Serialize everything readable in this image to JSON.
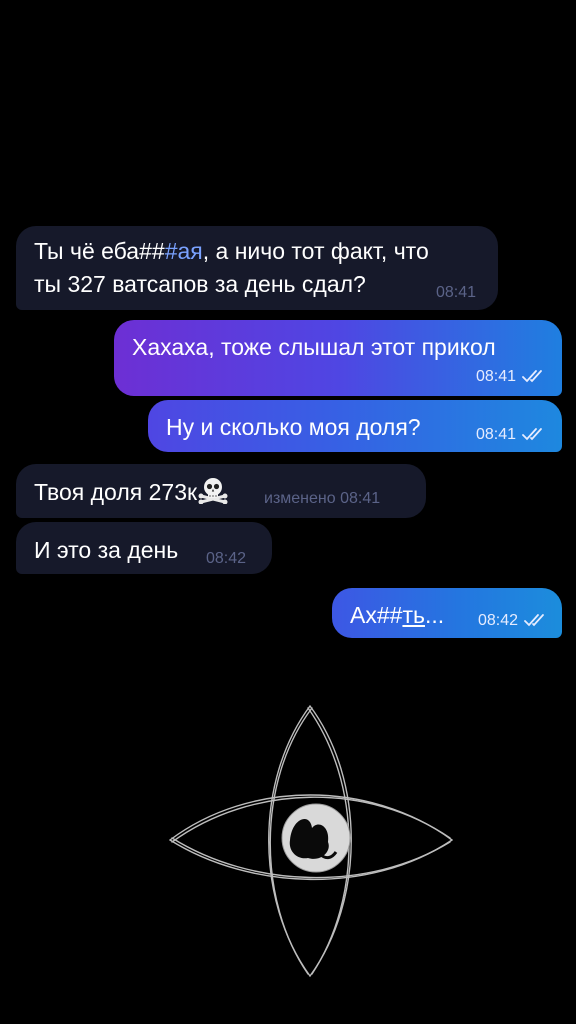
{
  "messages": [
    {
      "direction": "incoming",
      "text_part1": "Ты чё еба##",
      "text_link": "#ая",
      "text_part2": ", а ничо тот факт, что",
      "text_line2": "ты 327 ватсапов за день сдал?",
      "time": "08:41"
    },
    {
      "direction": "outgoing",
      "text": "Хахаха, тоже слышал этот прикол",
      "time": "08:41",
      "status": "read"
    },
    {
      "direction": "outgoing",
      "text": "Ну и сколько моя доля?",
      "time": "08:41",
      "status": "read"
    },
    {
      "direction": "incoming",
      "text": "Твоя доля 273к",
      "emoji": "skull-and-crossbones",
      "edited_label": "изменено",
      "time": "08:41"
    },
    {
      "direction": "incoming",
      "text": "И это за день",
      "time": "08:42"
    },
    {
      "direction": "outgoing",
      "text_part1": "Ах##",
      "text_link": "ть",
      "text_part2": "...",
      "time": "08:42",
      "status": "read"
    }
  ],
  "colors": {
    "background": "#000000",
    "incoming_bubble": "#16192a",
    "outgoing_gradient_start": "#6d2fd4",
    "outgoing_gradient_end": "#1c8ddc",
    "link": "#7aa2ff"
  },
  "decoration": {
    "icon": "sketched-eye-icon"
  }
}
